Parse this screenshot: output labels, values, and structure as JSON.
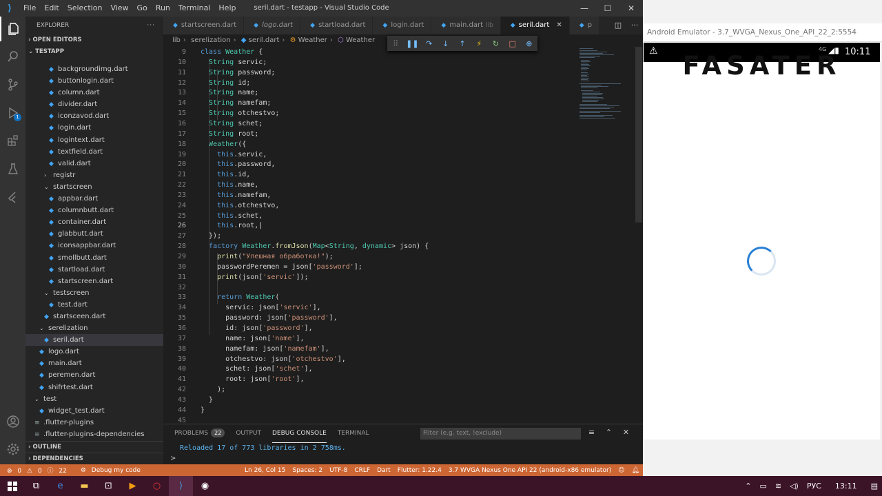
{
  "window": {
    "title": "seril.dart - testapp - Visual Studio Code",
    "menu": [
      "File",
      "Edit",
      "Selection",
      "View",
      "Go",
      "Run",
      "Terminal",
      "Help"
    ],
    "controls": {
      "minimize": "—",
      "maximize": "☐",
      "close": "✕"
    }
  },
  "sidebar": {
    "header": "EXPLORER",
    "more": "···",
    "open_editors": "OPEN EDITORS",
    "root": "TESTAPP",
    "items": [
      {
        "label": "backgroundimg.dart",
        "indent": 4,
        "kind": "file"
      },
      {
        "label": "buttonlogin.dart",
        "indent": 4,
        "kind": "file"
      },
      {
        "label": "column.dart",
        "indent": 4,
        "kind": "file"
      },
      {
        "label": "divider.dart",
        "indent": 4,
        "kind": "file"
      },
      {
        "label": "iconzavod.dart",
        "indent": 4,
        "kind": "file"
      },
      {
        "label": "login.dart",
        "indent": 4,
        "kind": "file"
      },
      {
        "label": "logintext.dart",
        "indent": 4,
        "kind": "file"
      },
      {
        "label": "textfield.dart",
        "indent": 4,
        "kind": "file"
      },
      {
        "label": "valid.dart",
        "indent": 4,
        "kind": "file"
      },
      {
        "label": "registr",
        "indent": 3,
        "kind": "folder-closed"
      },
      {
        "label": "startscreen",
        "indent": 3,
        "kind": "folder-open"
      },
      {
        "label": "appbar.dart",
        "indent": 4,
        "kind": "file"
      },
      {
        "label": "columnbutt.dart",
        "indent": 4,
        "kind": "file"
      },
      {
        "label": "container.dart",
        "indent": 4,
        "kind": "file"
      },
      {
        "label": "glabbutt.dart",
        "indent": 4,
        "kind": "file"
      },
      {
        "label": "iconsappbar.dart",
        "indent": 4,
        "kind": "file"
      },
      {
        "label": "smollbutt.dart",
        "indent": 4,
        "kind": "file"
      },
      {
        "label": "startload.dart",
        "indent": 4,
        "kind": "file"
      },
      {
        "label": "startscreen.dart",
        "indent": 4,
        "kind": "file"
      },
      {
        "label": "testscreen",
        "indent": 3,
        "kind": "folder-open"
      },
      {
        "label": "test.dart",
        "indent": 4,
        "kind": "file"
      },
      {
        "label": "startsceen.dart",
        "indent": 3,
        "kind": "file"
      },
      {
        "label": "serelization",
        "indent": 2,
        "kind": "folder-open"
      },
      {
        "label": "seril.dart",
        "indent": 3,
        "kind": "file",
        "selected": true
      },
      {
        "label": "logo.dart",
        "indent": 2,
        "kind": "file"
      },
      {
        "label": "main.dart",
        "indent": 2,
        "kind": "file"
      },
      {
        "label": "peremen.dart",
        "indent": 2,
        "kind": "file"
      },
      {
        "label": "shifrtest.dart",
        "indent": 2,
        "kind": "file"
      },
      {
        "label": "test",
        "indent": 1,
        "kind": "folder-open"
      },
      {
        "label": "widget_test.dart",
        "indent": 2,
        "kind": "file"
      },
      {
        "label": ".flutter-plugins",
        "indent": 1,
        "kind": "plain"
      },
      {
        "label": ".flutter-plugins-dependencies",
        "indent": 1,
        "kind": "plain"
      }
    ],
    "outline": "OUTLINE",
    "dependencies": "DEPENDENCIES"
  },
  "tabs": [
    {
      "label": "startscreen.dart",
      "italic": false
    },
    {
      "label": "logo.dart",
      "italic": true
    },
    {
      "label": "startload.dart",
      "italic": false
    },
    {
      "label": "login.dart",
      "italic": false
    },
    {
      "label": "main.dart",
      "italic": false,
      "desc": "lib"
    },
    {
      "label": "seril.dart",
      "italic": false,
      "active": true
    },
    {
      "label": "p",
      "italic": false
    }
  ],
  "breadcrumb": [
    "lib",
    "serelization",
    "seril.dart",
    "Weather",
    "Weather"
  ],
  "editor": {
    "current_line": 26,
    "lines": [
      {
        "n": 9,
        "t": [
          [
            "kw",
            "class "
          ],
          [
            "ty",
            "Weather"
          ],
          [
            "pl",
            " {"
          ]
        ]
      },
      {
        "n": 10,
        "t": [
          [
            "pl",
            "  "
          ],
          [
            "ty",
            "String"
          ],
          [
            "pl",
            " servic;"
          ]
        ]
      },
      {
        "n": 11,
        "t": [
          [
            "pl",
            "  "
          ],
          [
            "ty",
            "String"
          ],
          [
            "pl",
            " password;"
          ]
        ]
      },
      {
        "n": 12,
        "t": [
          [
            "pl",
            "  "
          ],
          [
            "ty",
            "String"
          ],
          [
            "pl",
            " id;"
          ]
        ]
      },
      {
        "n": 13,
        "t": [
          [
            "pl",
            "  "
          ],
          [
            "ty",
            "String"
          ],
          [
            "pl",
            " name;"
          ]
        ]
      },
      {
        "n": 14,
        "t": [
          [
            "pl",
            "  "
          ],
          [
            "ty",
            "String"
          ],
          [
            "pl",
            " namefam;"
          ]
        ]
      },
      {
        "n": 15,
        "t": [
          [
            "pl",
            "  "
          ],
          [
            "ty",
            "String"
          ],
          [
            "pl",
            " otchestvo;"
          ]
        ]
      },
      {
        "n": 16,
        "t": [
          [
            "pl",
            "  "
          ],
          [
            "ty",
            "String"
          ],
          [
            "pl",
            " schet;"
          ]
        ]
      },
      {
        "n": 17,
        "t": [
          [
            "pl",
            "  "
          ],
          [
            "ty",
            "String"
          ],
          [
            "pl",
            " root;"
          ]
        ]
      },
      {
        "n": 18,
        "t": [
          [
            "pl",
            "  "
          ],
          [
            "ty",
            "Weather"
          ],
          [
            "pl",
            "({"
          ]
        ]
      },
      {
        "n": 19,
        "t": [
          [
            "pl",
            "    "
          ],
          [
            "kw",
            "this"
          ],
          [
            "pl",
            ".servic,"
          ]
        ]
      },
      {
        "n": 20,
        "t": [
          [
            "pl",
            "    "
          ],
          [
            "kw",
            "this"
          ],
          [
            "pl",
            ".password,"
          ]
        ]
      },
      {
        "n": 21,
        "t": [
          [
            "pl",
            "    "
          ],
          [
            "kw",
            "this"
          ],
          [
            "pl",
            ".id,"
          ]
        ]
      },
      {
        "n": 22,
        "t": [
          [
            "pl",
            "    "
          ],
          [
            "kw",
            "this"
          ],
          [
            "pl",
            ".name,"
          ]
        ]
      },
      {
        "n": 23,
        "t": [
          [
            "pl",
            "    "
          ],
          [
            "kw",
            "this"
          ],
          [
            "pl",
            ".namefam,"
          ]
        ]
      },
      {
        "n": 24,
        "t": [
          [
            "pl",
            "    "
          ],
          [
            "kw",
            "this"
          ],
          [
            "pl",
            ".otchestvo,"
          ]
        ]
      },
      {
        "n": 25,
        "t": [
          [
            "pl",
            "    "
          ],
          [
            "kw",
            "this"
          ],
          [
            "pl",
            ".schet,"
          ]
        ]
      },
      {
        "n": 26,
        "t": [
          [
            "pl",
            "    "
          ],
          [
            "kw",
            "this"
          ],
          [
            "pl",
            ".root,|"
          ]
        ]
      },
      {
        "n": 27,
        "t": [
          [
            "pl",
            "  });"
          ]
        ]
      },
      {
        "n": 28,
        "t": [
          [
            "pl",
            "  "
          ],
          [
            "kw",
            "factory "
          ],
          [
            "ty",
            "Weather"
          ],
          [
            "pl",
            "."
          ],
          [
            "fn",
            "fromJson"
          ],
          [
            "pl",
            "("
          ],
          [
            "ty",
            "Map"
          ],
          [
            "pl",
            "<"
          ],
          [
            "ty",
            "String"
          ],
          [
            "pl",
            ", "
          ],
          [
            "ty",
            "dynamic"
          ],
          [
            "pl",
            "> json) {"
          ]
        ]
      },
      {
        "n": 29,
        "t": [
          [
            "pl",
            "    "
          ],
          [
            "fn",
            "print"
          ],
          [
            "pl",
            "("
          ],
          [
            "st",
            "\"Улешная обработка!\""
          ],
          [
            "pl",
            ");"
          ]
        ]
      },
      {
        "n": 30,
        "t": [
          [
            "pl",
            "    passwordPeremen = json["
          ],
          [
            "st",
            "'password'"
          ],
          [
            "pl",
            "];"
          ]
        ]
      },
      {
        "n": 31,
        "t": [
          [
            "pl",
            "    "
          ],
          [
            "fn",
            "print"
          ],
          [
            "pl",
            "(json["
          ],
          [
            "st",
            "'servic'"
          ],
          [
            "pl",
            "]);"
          ]
        ]
      },
      {
        "n": 32,
        "t": [
          [
            "pl",
            ""
          ]
        ]
      },
      {
        "n": 33,
        "t": [
          [
            "pl",
            "    "
          ],
          [
            "kw",
            "return "
          ],
          [
            "ty",
            "Weather"
          ],
          [
            "pl",
            "("
          ]
        ]
      },
      {
        "n": 34,
        "t": [
          [
            "pl",
            "      servic: json["
          ],
          [
            "st",
            "'servic'"
          ],
          [
            "pl",
            "],"
          ]
        ]
      },
      {
        "n": 35,
        "t": [
          [
            "pl",
            "      password: json["
          ],
          [
            "st",
            "'password'"
          ],
          [
            "pl",
            "],"
          ]
        ]
      },
      {
        "n": 36,
        "t": [
          [
            "pl",
            "      id: json["
          ],
          [
            "st",
            "'password'"
          ],
          [
            "pl",
            "],"
          ]
        ]
      },
      {
        "n": 37,
        "t": [
          [
            "pl",
            "      name: json["
          ],
          [
            "st",
            "'name'"
          ],
          [
            "pl",
            "],"
          ]
        ]
      },
      {
        "n": 38,
        "t": [
          [
            "pl",
            "      namefam: json["
          ],
          [
            "st",
            "'namefam'"
          ],
          [
            "pl",
            "],"
          ]
        ]
      },
      {
        "n": 39,
        "t": [
          [
            "pl",
            "      otchestvo: json["
          ],
          [
            "st",
            "'otchestvo'"
          ],
          [
            "pl",
            "],"
          ]
        ]
      },
      {
        "n": 40,
        "t": [
          [
            "pl",
            "      schet: json["
          ],
          [
            "st",
            "'schet'"
          ],
          [
            "pl",
            "],"
          ]
        ]
      },
      {
        "n": 41,
        "t": [
          [
            "pl",
            "      root: json["
          ],
          [
            "st",
            "'root'"
          ],
          [
            "pl",
            "],"
          ]
        ]
      },
      {
        "n": 42,
        "t": [
          [
            "pl",
            "    );"
          ]
        ]
      },
      {
        "n": 43,
        "t": [
          [
            "pl",
            "  }"
          ]
        ]
      },
      {
        "n": 44,
        "t": [
          [
            "pl",
            "}"
          ]
        ]
      },
      {
        "n": 45,
        "t": [
          [
            "pl",
            ""
          ]
        ]
      }
    ]
  },
  "panel": {
    "tabs": [
      "PROBLEMS",
      "OUTPUT",
      "DEBUG CONSOLE",
      "TERMINAL"
    ],
    "problems_count": "22",
    "active": "DEBUG CONSOLE",
    "filter_placeholder": "Filter (e.g. text, !exclude)",
    "output": "Reloaded 17 of 773 libraries in 2 758ms.",
    "prompt": ">"
  },
  "statusbar": {
    "errors": "0",
    "warnings": "0",
    "infos": "22",
    "debug": "Debug my code",
    "position": "Ln 26, Col 15",
    "spaces": "Spaces: 2",
    "encoding": "UTF-8",
    "eol": "CRLF",
    "language": "Dart",
    "flutter": "Flutter: 1.22.4",
    "device": "3.7 WVGA Nexus One API 22 (android-x86 emulator)",
    "color": "#cc6633"
  },
  "emulator": {
    "title": "Android Emulator - 3.7_WVGA_Nexus_One_API_22_2:5554",
    "time": "10:11",
    "network": "4G",
    "app_title": "FASATER"
  },
  "taskbar": {
    "lang": "РУС",
    "clock": "13:11"
  }
}
